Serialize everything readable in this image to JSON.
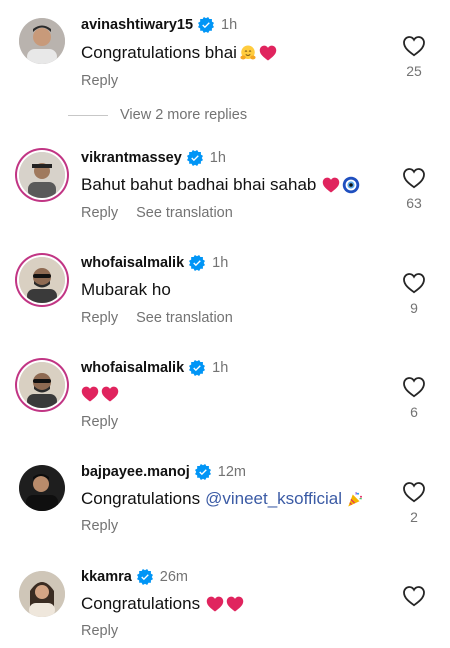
{
  "comments": [
    {
      "username": "avinashtiwary15",
      "time": "1h",
      "text": "Congratulations bhai",
      "emojis": [
        "hugging-emoji",
        "red-heart-emoji"
      ],
      "reply_label": "Reply",
      "like_count": "25"
    },
    {
      "username": "vikrantmassey",
      "time": "1h",
      "text": "Bahut bahut badhai bhai sahab",
      "emojis": [
        "red-heart-emoji",
        "nazar-amulet-emoji"
      ],
      "reply_label": "Reply",
      "translate_label": "See translation",
      "like_count": "63"
    },
    {
      "username": "whofaisalmalik",
      "time": "1h",
      "text": "Mubarak ho",
      "reply_label": "Reply",
      "translate_label": "See translation",
      "like_count": "9"
    },
    {
      "username": "whofaisalmalik",
      "time": "1h",
      "text": "",
      "emojis": [
        "red-heart-emoji",
        "red-heart-emoji"
      ],
      "reply_label": "Reply",
      "like_count": "6"
    },
    {
      "username": "bajpayee.manoj",
      "time": "12m",
      "text": "Congratulations",
      "mention": "@vineet_ksofficial",
      "emojis": [
        "party-popper-emoji"
      ],
      "reply_label": "Reply",
      "like_count": "2"
    },
    {
      "username": "kkamra",
      "time": "26m",
      "text": "Congratulations",
      "emojis": [
        "red-heart-emoji",
        "red-heart-emoji"
      ],
      "reply_label": "Reply"
    }
  ],
  "view_more_replies": "View 2 more replies",
  "colors": {
    "verified": "#0095f6",
    "muted": "#737373",
    "mention": "#3b5ba5",
    "heart": "#e0245e"
  }
}
